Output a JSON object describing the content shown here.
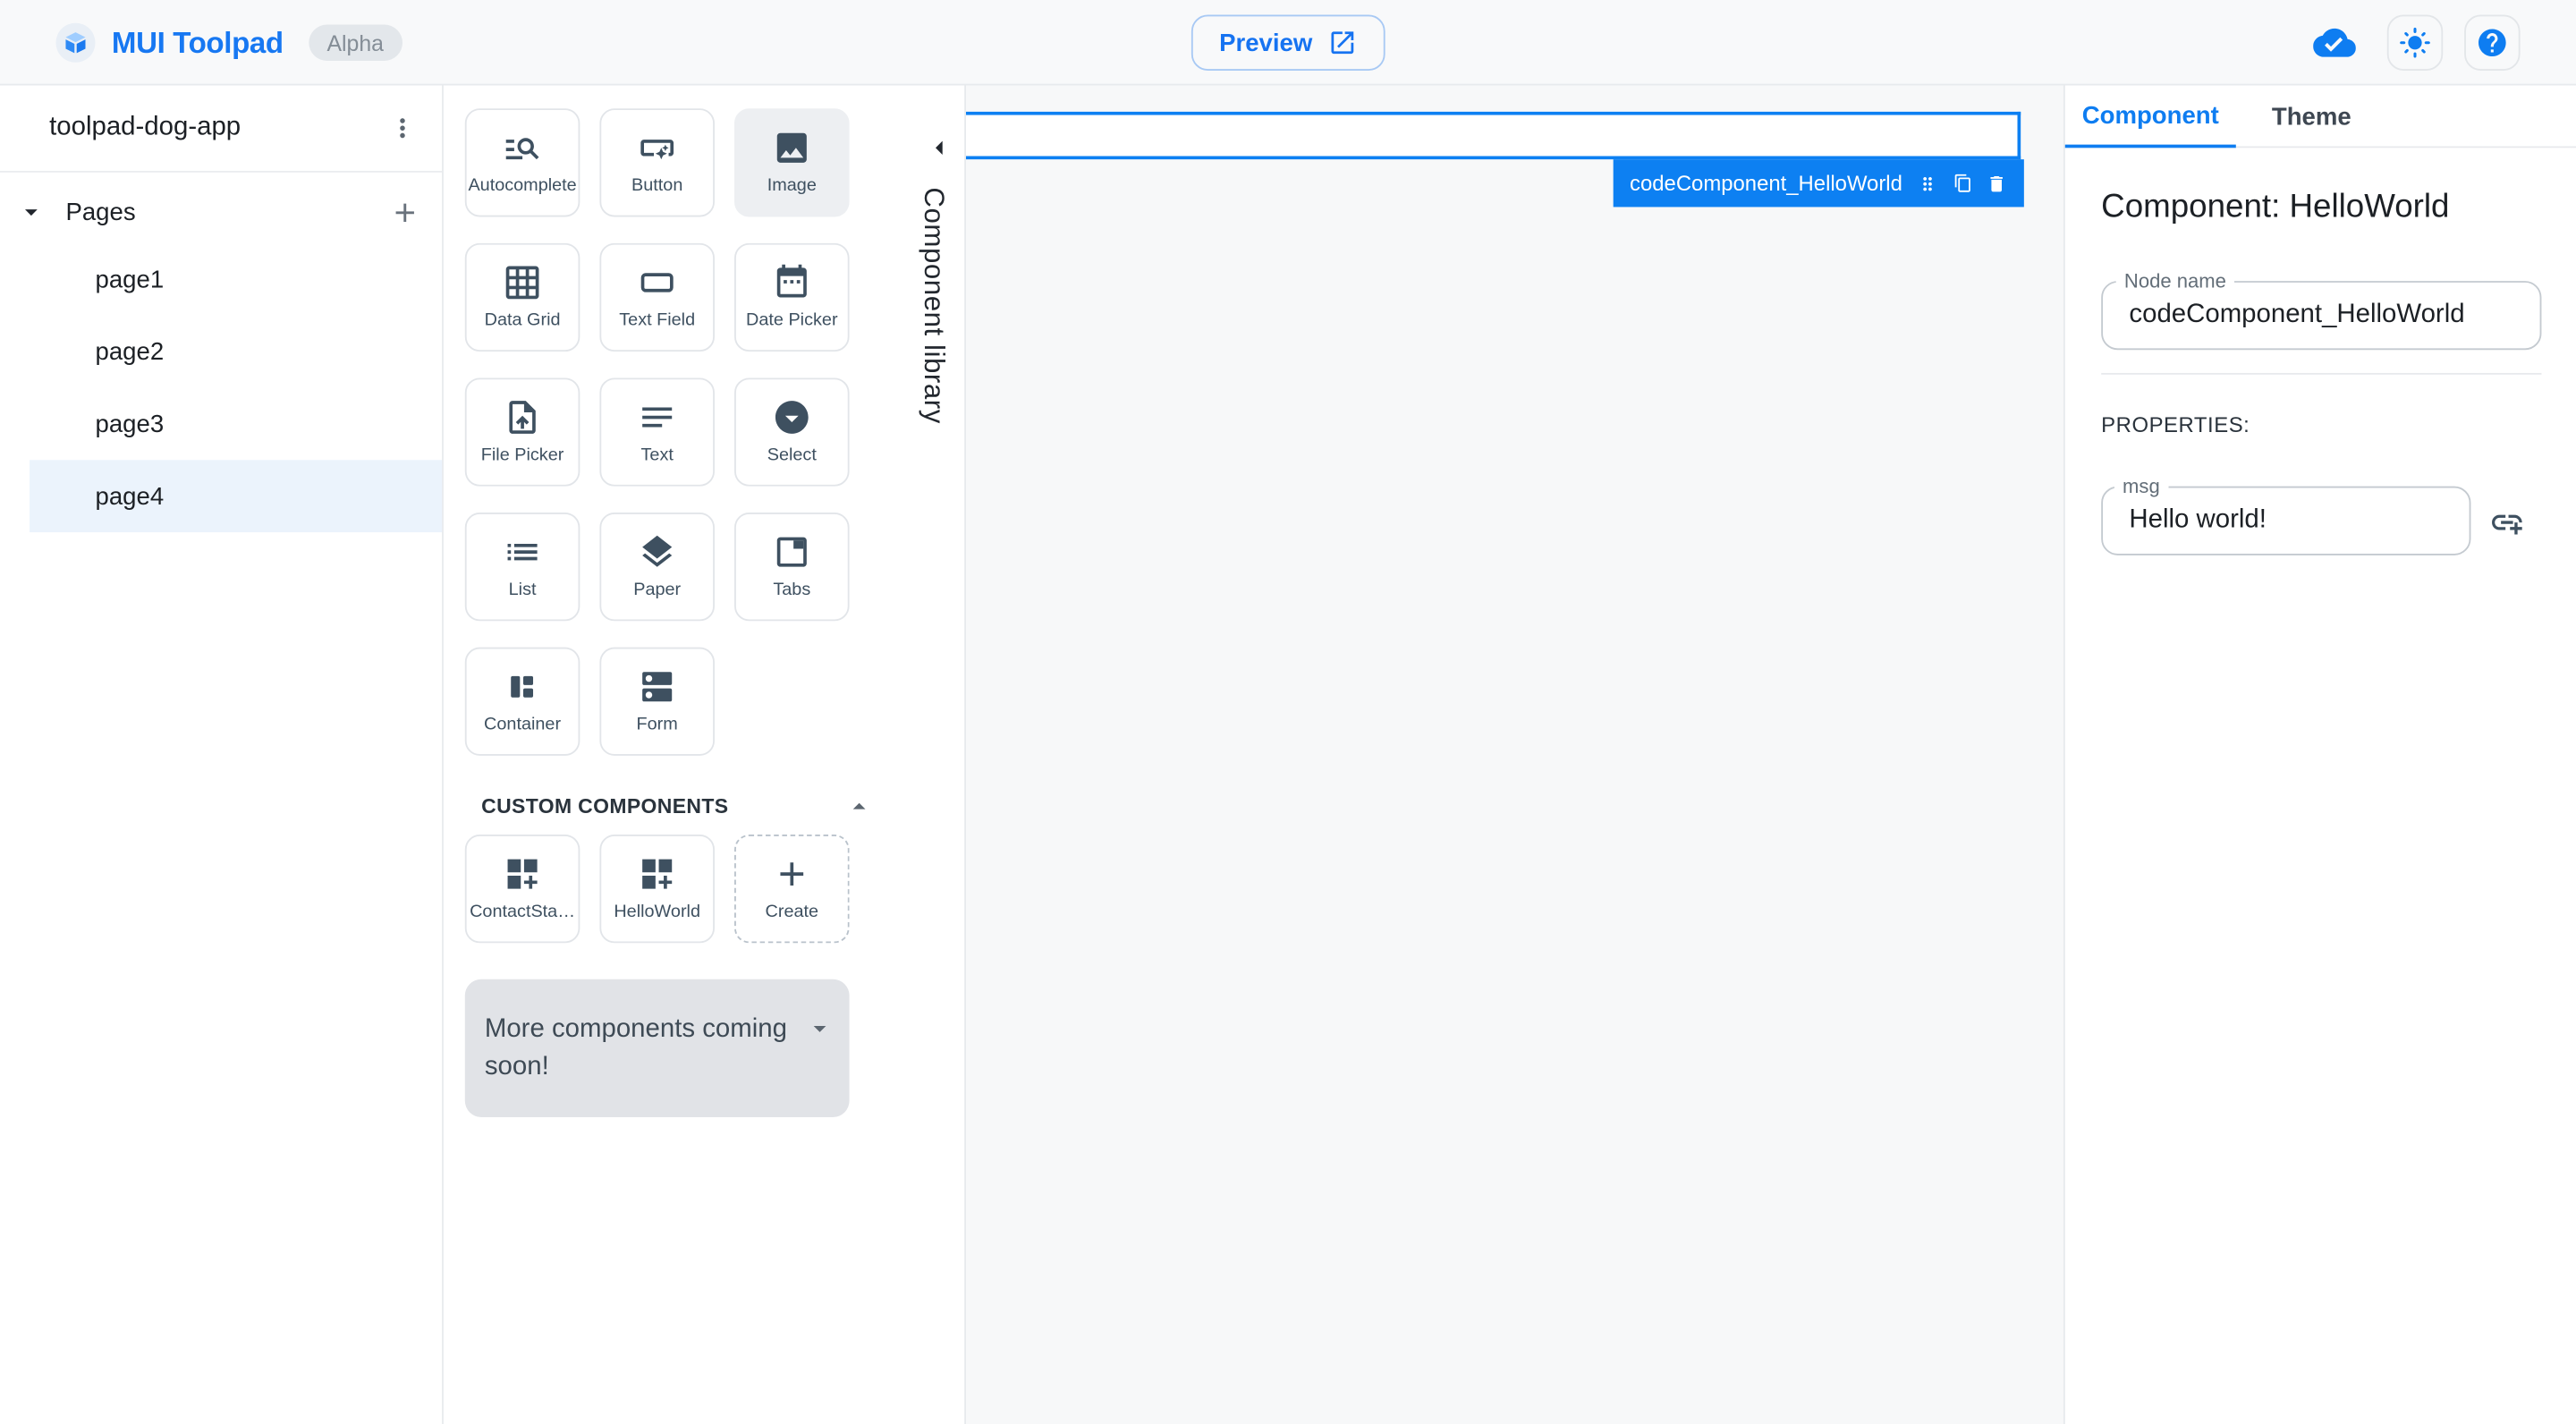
{
  "header": {
    "app_title": "MUI Toolpad",
    "badge": "Alpha",
    "preview_label": "Preview"
  },
  "sidebar": {
    "project_name": "toolpad-dog-app",
    "pages_label": "Pages",
    "pages": [
      {
        "label": "page1",
        "active": false
      },
      {
        "label": "page2",
        "active": false
      },
      {
        "label": "page3",
        "active": false
      },
      {
        "label": "page4",
        "active": true
      }
    ]
  },
  "library": {
    "panel_label": "Component library",
    "components": [
      {
        "label": "Autocomplete",
        "icon": "manage-search-icon"
      },
      {
        "label": "Button",
        "icon": "smart-button-icon"
      },
      {
        "label": "Image",
        "icon": "image-icon",
        "highlighted": true
      },
      {
        "label": "Data Grid",
        "icon": "grid-icon"
      },
      {
        "label": "Text Field",
        "icon": "text-field-icon"
      },
      {
        "label": "Date Picker",
        "icon": "calendar-icon"
      },
      {
        "label": "File Picker",
        "icon": "upload-file-icon"
      },
      {
        "label": "Text",
        "icon": "notes-icon"
      },
      {
        "label": "Select",
        "icon": "arrow-drop-down-circle-icon"
      },
      {
        "label": "List",
        "icon": "list-icon"
      },
      {
        "label": "Paper",
        "icon": "layers-icon"
      },
      {
        "label": "Tabs",
        "icon": "tab-icon"
      },
      {
        "label": "Container",
        "icon": "container-icon"
      },
      {
        "label": "Form",
        "icon": "dns-icon"
      }
    ],
    "custom_section_label": "CUSTOM COMPONENTS",
    "custom_components": [
      {
        "label": "ContactSta…",
        "icon": "dashboard-customize-icon"
      },
      {
        "label": "HelloWorld",
        "icon": "dashboard-customize-icon"
      },
      {
        "label": "Create",
        "icon": "plus-icon"
      }
    ],
    "coming_soon_text": "More components coming soon!"
  },
  "canvas": {
    "selected_node_label": "codeComponent_HelloWorld"
  },
  "inspector": {
    "tabs": [
      {
        "label": "Component",
        "active": true
      },
      {
        "label": "Theme",
        "active": false
      }
    ],
    "title": "Component: HelloWorld",
    "node_name_field": {
      "label": "Node name",
      "value": "codeComponent_HelloWorld"
    },
    "properties_label": "PROPERTIES:",
    "msg_field": {
      "label": "msg",
      "value": "Hello world!"
    }
  },
  "colors": {
    "accent_blue": "#0E7DF1",
    "selection_blue": "#0D80F2",
    "icon_slate": "#3E5060",
    "text_dark": "#1C2025",
    "header_bg": "#F8F9FA",
    "canvas_bg": "#F7F8F9",
    "active_page_bg": "#EBF3FC"
  }
}
